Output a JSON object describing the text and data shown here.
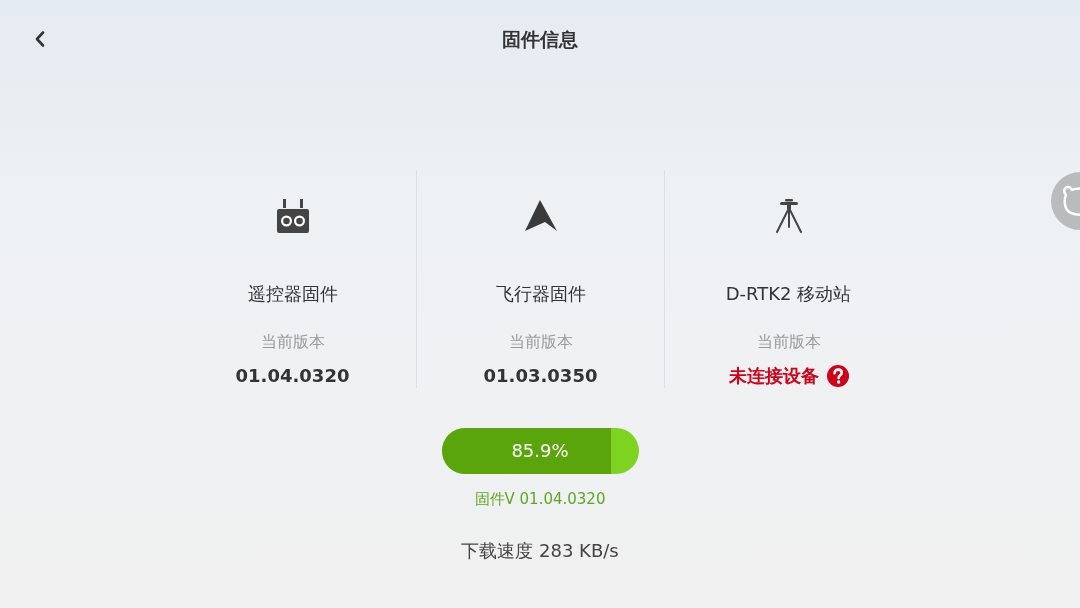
{
  "header": {
    "title": "固件信息"
  },
  "modules": [
    {
      "name": "遥控器固件",
      "version_label": "当前版本",
      "version": "01.04.0320",
      "kind": "ok"
    },
    {
      "name": "飞行器固件",
      "version_label": "当前版本",
      "version": "01.03.0350",
      "kind": "ok"
    },
    {
      "name": "D-RTK2 移动站",
      "version_label": "当前版本",
      "version": "未连接设备",
      "kind": "alert"
    }
  ],
  "download": {
    "progress": {
      "level": 0.859,
      "reading": "85.9%"
    },
    "firmware": "固件V 01.04.0320",
    "speed": "下载速度 283 KB/s"
  }
}
